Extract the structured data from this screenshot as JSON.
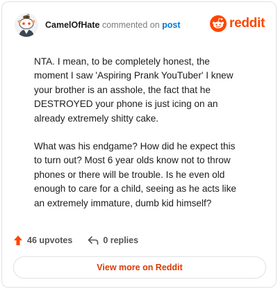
{
  "header": {
    "username": "CamelOfHate",
    "action": "commented on",
    "target": "post",
    "avatar_icon": "snoo-avatar-icon",
    "brand": {
      "icon": "reddit-logo-icon",
      "text": "reddit",
      "color": "#ff4500"
    }
  },
  "comment": {
    "paragraphs": [
      "NTA. I mean, to be completely honest, the moment I saw 'Aspiring Prank YouTuber' I knew your brother is an asshole, the fact that he DESTROYED your phone is just icing on an already extremely shitty cake.",
      "What was his endgame? How did he expect this to turn out? Most 6 year olds know not to throw phones or there will be trouble. Is he even old enough to care for a child, seeing as he acts like an extremely immature, dumb kid himself?"
    ]
  },
  "stats": {
    "upvotes": "46 upvotes",
    "replies": "0 replies",
    "upvote_icon": "upvote-arrow-icon",
    "reply_icon": "reply-arrow-icon",
    "upvote_color": "#ff4500"
  },
  "footer": {
    "button_label": "View more on Reddit",
    "button_color": "#d93a00"
  }
}
